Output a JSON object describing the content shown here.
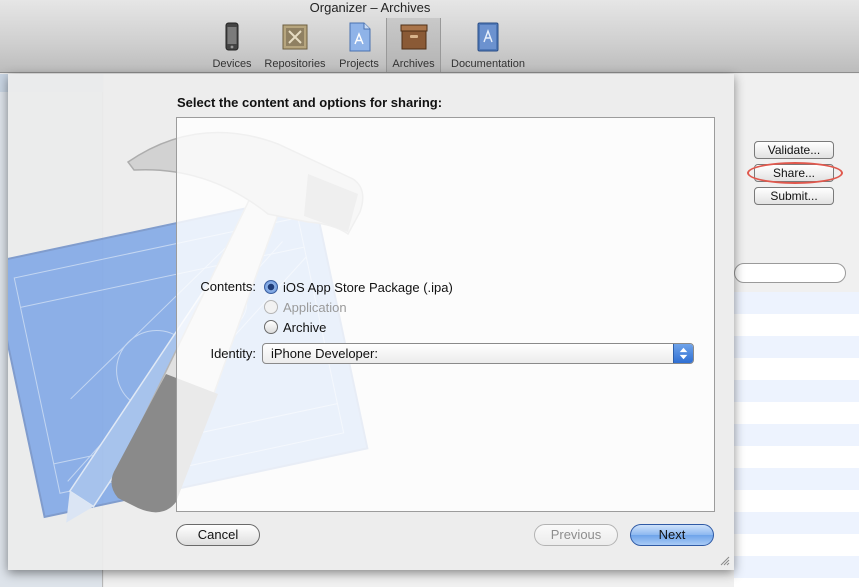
{
  "window": {
    "title": "Organizer – Archives"
  },
  "toolbar": {
    "items": [
      {
        "label": "Devices",
        "icon": "device-icon"
      },
      {
        "label": "Repositories",
        "icon": "repository-icon"
      },
      {
        "label": "Projects",
        "icon": "projects-icon"
      },
      {
        "label": "Archives",
        "icon": "archive-box-icon",
        "selected": true
      },
      {
        "label": "Documentation",
        "icon": "documentation-icon"
      }
    ]
  },
  "side_actions": {
    "validate_label": "Validate...",
    "share_label": "Share...",
    "submit_label": "Submit..."
  },
  "sheet": {
    "heading": "Select the content and options for sharing:",
    "contents_label": "Contents:",
    "options": [
      {
        "label": "iOS App Store Package (.ipa)",
        "checked": true,
        "enabled": true
      },
      {
        "label": "Application",
        "checked": false,
        "enabled": false
      },
      {
        "label": "Archive",
        "checked": false,
        "enabled": true
      }
    ],
    "identity_label": "Identity:",
    "identity_value": "iPhone Developer:",
    "cancel_label": "Cancel",
    "previous_label": "Previous",
    "next_label": "Next"
  },
  "colors": {
    "accent": "#3a74d8",
    "highlight_oval": "#e0584d",
    "blueprint": "#3f7fe3"
  }
}
